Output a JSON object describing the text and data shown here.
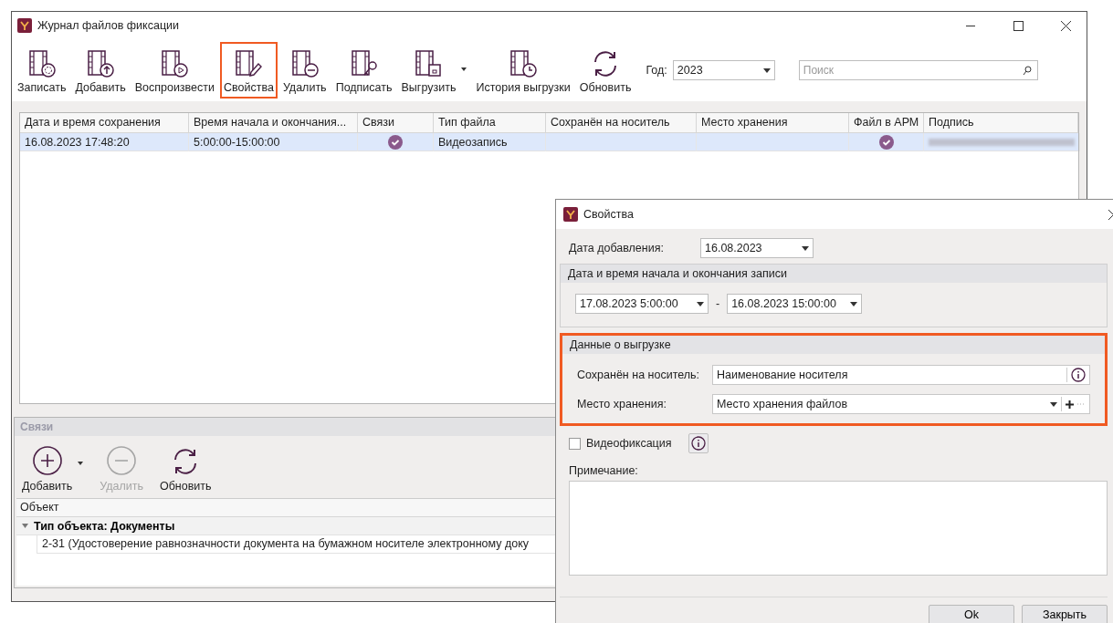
{
  "window": {
    "title": "Журнал файлов фиксации"
  },
  "toolbar": [
    {
      "label": "Записать",
      "kind": "record",
      "selected": false,
      "dropdown": false
    },
    {
      "label": "Добавить",
      "kind": "upload",
      "selected": false,
      "dropdown": false
    },
    {
      "label": "Воспроизвести",
      "kind": "play",
      "selected": false,
      "dropdown": false
    },
    {
      "label": "Свойства",
      "kind": "edit",
      "selected": true,
      "dropdown": false
    },
    {
      "label": "Удалить",
      "kind": "minus",
      "selected": false,
      "dropdown": false
    },
    {
      "label": "Подписать",
      "kind": "key",
      "selected": false,
      "dropdown": false
    },
    {
      "label": "Выгрузить",
      "kind": "save",
      "selected": false,
      "dropdown": true
    },
    {
      "label": "История выгрузки",
      "kind": "history",
      "selected": false,
      "dropdown": false
    },
    {
      "label": "Обновить",
      "kind": "refresh",
      "selected": false,
      "dropdown": false
    }
  ],
  "year": {
    "label": "Год:",
    "value": "2023"
  },
  "search": {
    "placeholder": "Поиск"
  },
  "table": {
    "columns": [
      "Дата и время сохранения",
      "Время начала и окончания...",
      "Связи",
      "Тип файла",
      "Сохранён на носитель",
      "Место хранения",
      "Файл в АРМ",
      "Подпись"
    ],
    "rows": [
      {
        "saved": "16.08.2023 17:48:20",
        "period": "5:00:00-15:00:00",
        "links": true,
        "file_type": "Видеозапись",
        "file_in_arm": true,
        "selected": true
      }
    ]
  },
  "links_panel": {
    "title": "Связи",
    "buttons": [
      {
        "label": "Добавить",
        "kind": "plus",
        "disabled": false,
        "dropdown": true
      },
      {
        "label": "Удалить",
        "kind": "minus",
        "disabled": true,
        "dropdown": false
      },
      {
        "label": "Обновить",
        "kind": "refresh",
        "disabled": false,
        "dropdown": false
      }
    ],
    "column": "Объект",
    "groups": [
      {
        "title": "Тип объекта: Документы",
        "expanded": true,
        "children": [
          "2-31 (Удостоверение равнозначности документа на бумажном носителе электронному доку"
        ]
      }
    ]
  },
  "dialog": {
    "title": "Свойства",
    "date_added": {
      "label": "Дата добавления:",
      "value": "16.08.2023"
    },
    "period": {
      "title": "Дата и время начала и окончания записи",
      "start": "17.08.2023 5:00:00",
      "separator": "-",
      "end": "16.08.2023 15:00:00"
    },
    "export": {
      "title": "Данные о выгрузке",
      "highlighted": true,
      "media": {
        "label": "Сохранён на носитель:",
        "value": "Наименование носителя"
      },
      "storage": {
        "label": "Место хранения:",
        "value": "Место хранения файлов"
      }
    },
    "video": {
      "label": "Видеофиксация",
      "checked": false
    },
    "note": {
      "label": "Примечание:"
    },
    "buttons": [
      "Ok",
      "Закрыть"
    ]
  }
}
